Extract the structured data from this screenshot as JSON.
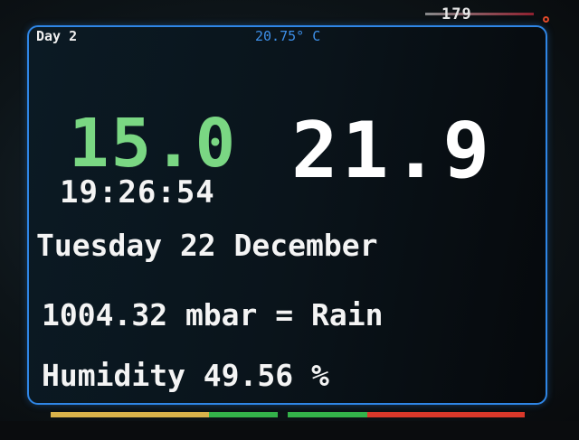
{
  "device": {
    "counter": "179"
  },
  "header": {
    "day": "Day 2",
    "temperature": "20.75° C"
  },
  "readings": {
    "left_value": "15.0",
    "right_value": "21.9",
    "time": "19:26:54"
  },
  "details": {
    "date": "Tuesday 22 December",
    "pressure": "1004.32 mbar = Rain",
    "humidity": "Humidity 49.56 %"
  },
  "colors": {
    "accent_border": "#2f86e6",
    "left_value": "#7ad783",
    "header_temp": "#3d8fe8",
    "bar_yellow": "#d9b24a",
    "bar_green": "#34b34a",
    "bar_red": "#d9382a"
  }
}
